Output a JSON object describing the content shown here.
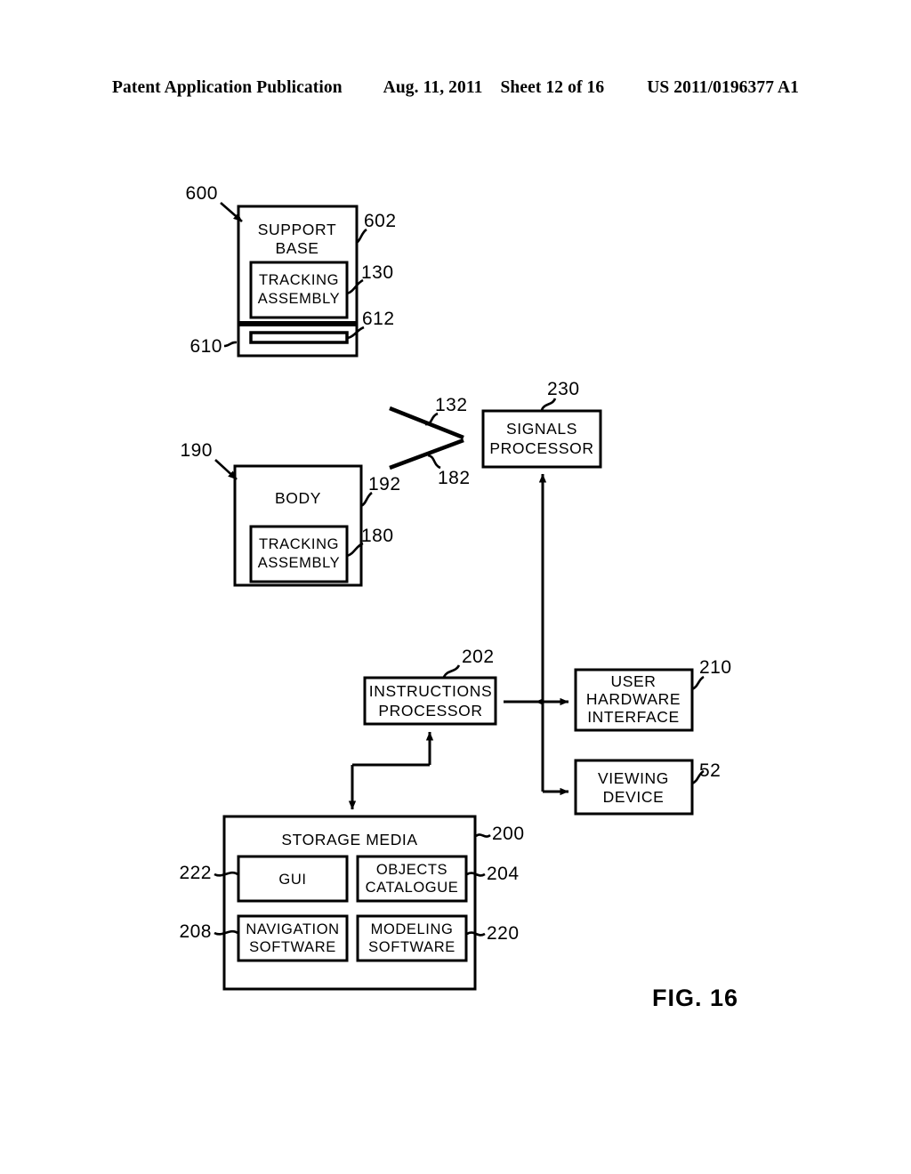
{
  "header": {
    "publication": "Patent Application Publication",
    "date": "Aug. 11, 2011",
    "sheet": "Sheet 12 of 16",
    "patent_number": "US 2011/0196377 A1"
  },
  "figure": {
    "caption": "FIG. 16"
  },
  "blocks": {
    "support_base": {
      "label_line1": "SUPPORT",
      "label_line2": "BASE",
      "ref": "600",
      "body_ref": "602",
      "tracking_label_line1": "TRACKING",
      "tracking_label_line2": "ASSEMBLY",
      "tracking_ref": "130",
      "lower_section_ref": "610",
      "bar_ref": "612"
    },
    "body": {
      "label": "BODY",
      "ref": "190",
      "edge_ref": "192",
      "tracking_label_line1": "TRACKING",
      "tracking_label_line2": "ASSEMBLY",
      "tracking_ref": "180"
    },
    "signals_processor": {
      "label_line1": "SIGNALS",
      "label_line2": "PROCESSOR",
      "ref": "230"
    },
    "instructions_processor": {
      "label_line1": "INSTRUCTIONS",
      "label_line2": "PROCESSOR",
      "ref": "202"
    },
    "user_hardware_interface": {
      "label_line1": "USER",
      "label_line2": "HARDWARE",
      "label_line3": "INTERFACE",
      "ref": "210"
    },
    "viewing_device": {
      "label_line1": "VIEWING",
      "label_line2": "DEVICE",
      "ref": "52"
    },
    "storage_media": {
      "label": "STORAGE MEDIA",
      "ref": "200",
      "gui": {
        "label": "GUI",
        "ref": "222"
      },
      "objects_catalogue": {
        "label_line1": "OBJECTS",
        "label_line2": "CATALOGUE",
        "ref": "204"
      },
      "navigation_software": {
        "label_line1": "NAVIGATION",
        "label_line2": "SOFTWARE",
        "ref": "208"
      },
      "modeling_software": {
        "label_line1": "MODELING",
        "label_line2": "SOFTWARE",
        "ref": "220"
      }
    }
  },
  "signals": {
    "upper_ref": "132",
    "lower_ref": "182"
  }
}
